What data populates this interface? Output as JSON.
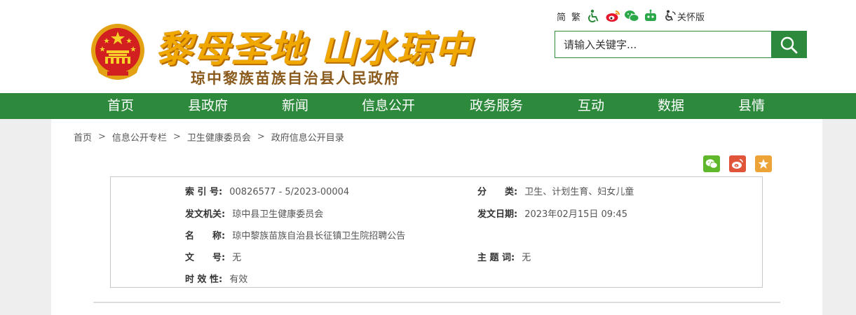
{
  "header": {
    "slogan": "黎母圣地 山水琼中",
    "subtitle": "琼中黎族苗族自治县人民政府",
    "tools": {
      "simplified": "简",
      "traditional": "繁",
      "care_mode": "关怀版"
    },
    "search": {
      "placeholder": "请输入关键字..."
    }
  },
  "nav": {
    "items": [
      "首页",
      "县政府",
      "新闻",
      "信息公开",
      "政务服务",
      "互动",
      "数据",
      "县情"
    ]
  },
  "breadcrumb": [
    "首页",
    "信息公开专栏",
    "卫生健康委员会",
    "政府信息公开目录"
  ],
  "info": {
    "index_label": "索 引 号:",
    "index_value": "00826577 - 5/2023-00004",
    "category_label": "分　　类:",
    "category_value": "卫生、计划生育、妇女儿童",
    "issuer_label": "发文机关:",
    "issuer_value": "琼中县卫生健康委员会",
    "date_label": "发文日期:",
    "date_value": "2023年02月15日 09:45",
    "name_label": "名　　称:",
    "name_value": "琼中黎族苗族自治县长征镇卫生院招聘公告",
    "docno_label": "文　　号:",
    "docno_value": "无",
    "subject_label": "主 题 词:",
    "subject_value": "无",
    "validity_label": "时 效 性:",
    "validity_value": "有效"
  },
  "colors": {
    "brand_green": "#2d8a3c",
    "slogan_gold": "#f0a800",
    "subtitle_brown": "#8a5a1c",
    "wechat_green": "#5fb82b",
    "weibo_red": "#e0553a",
    "favorite_orange": "#eda338"
  }
}
